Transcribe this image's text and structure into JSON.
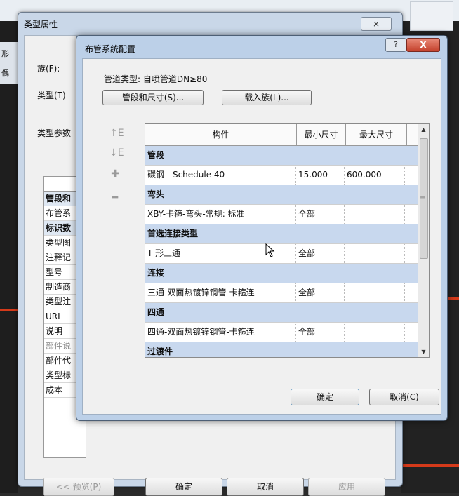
{
  "outer_dialog": {
    "title": "类型属性",
    "close_label": "⨯",
    "family_label": "族(F):",
    "type_label": "类型(T)",
    "type_params_label": "类型参数",
    "left_strip_label": "形",
    "left_strip_label2": "偶",
    "rows": [
      {
        "label": "管段和",
        "group": true
      },
      {
        "label": "布管系",
        "group": false
      },
      {
        "label": "标识数",
        "group": true
      },
      {
        "label": "类型图",
        "group": false
      },
      {
        "label": "注释记",
        "group": false
      },
      {
        "label": "型号",
        "group": false
      },
      {
        "label": "制造商",
        "group": false
      },
      {
        "label": "类型注",
        "group": false
      },
      {
        "label": "URL",
        "group": false
      },
      {
        "label": "说明",
        "group": false
      },
      {
        "label": "部件说",
        "group": false,
        "dim": true
      },
      {
        "label": "部件代",
        "group": false
      },
      {
        "label": "类型标",
        "group": false
      },
      {
        "label": "成本",
        "group": false
      }
    ],
    "buttons": {
      "preview": "<< 预览(P)",
      "ok": "确定",
      "cancel": "取消",
      "apply": "应用"
    }
  },
  "inner_dialog": {
    "title": "布管系统配置",
    "help_label": "?",
    "close_label": "X",
    "pipe_type": "管道类型: 自喷管道DN≥80",
    "segments_button": "管段和尺寸(S)...",
    "load_family_button": "载入族(L)...",
    "side_icons": [
      "↑E",
      "↓E",
      "✚",
      "━"
    ],
    "table": {
      "headers": [
        "构件",
        "最小尺寸",
        "最大尺寸"
      ],
      "rows": [
        {
          "group": "管段"
        },
        {
          "cells": [
            "碳钢 - Schedule 40",
            "15.000",
            "600.000"
          ]
        },
        {
          "group": "弯头"
        },
        {
          "cells": [
            "XBY-卡箍-弯头-常规: 标准",
            "全部",
            ""
          ]
        },
        {
          "group": "首选连接类型"
        },
        {
          "cells": [
            "T 形三通",
            "全部",
            ""
          ]
        },
        {
          "group": "连接"
        },
        {
          "cells": [
            "三通-双面热镀锌钢管-卡箍连",
            "全部",
            ""
          ]
        },
        {
          "group": "四通"
        },
        {
          "cells": [
            "四通-双面热镀锌钢管-卡箍连",
            "全部",
            ""
          ]
        },
        {
          "group": "过渡件"
        }
      ]
    },
    "ok_button": "确定",
    "cancel_button": "取消(C)"
  }
}
